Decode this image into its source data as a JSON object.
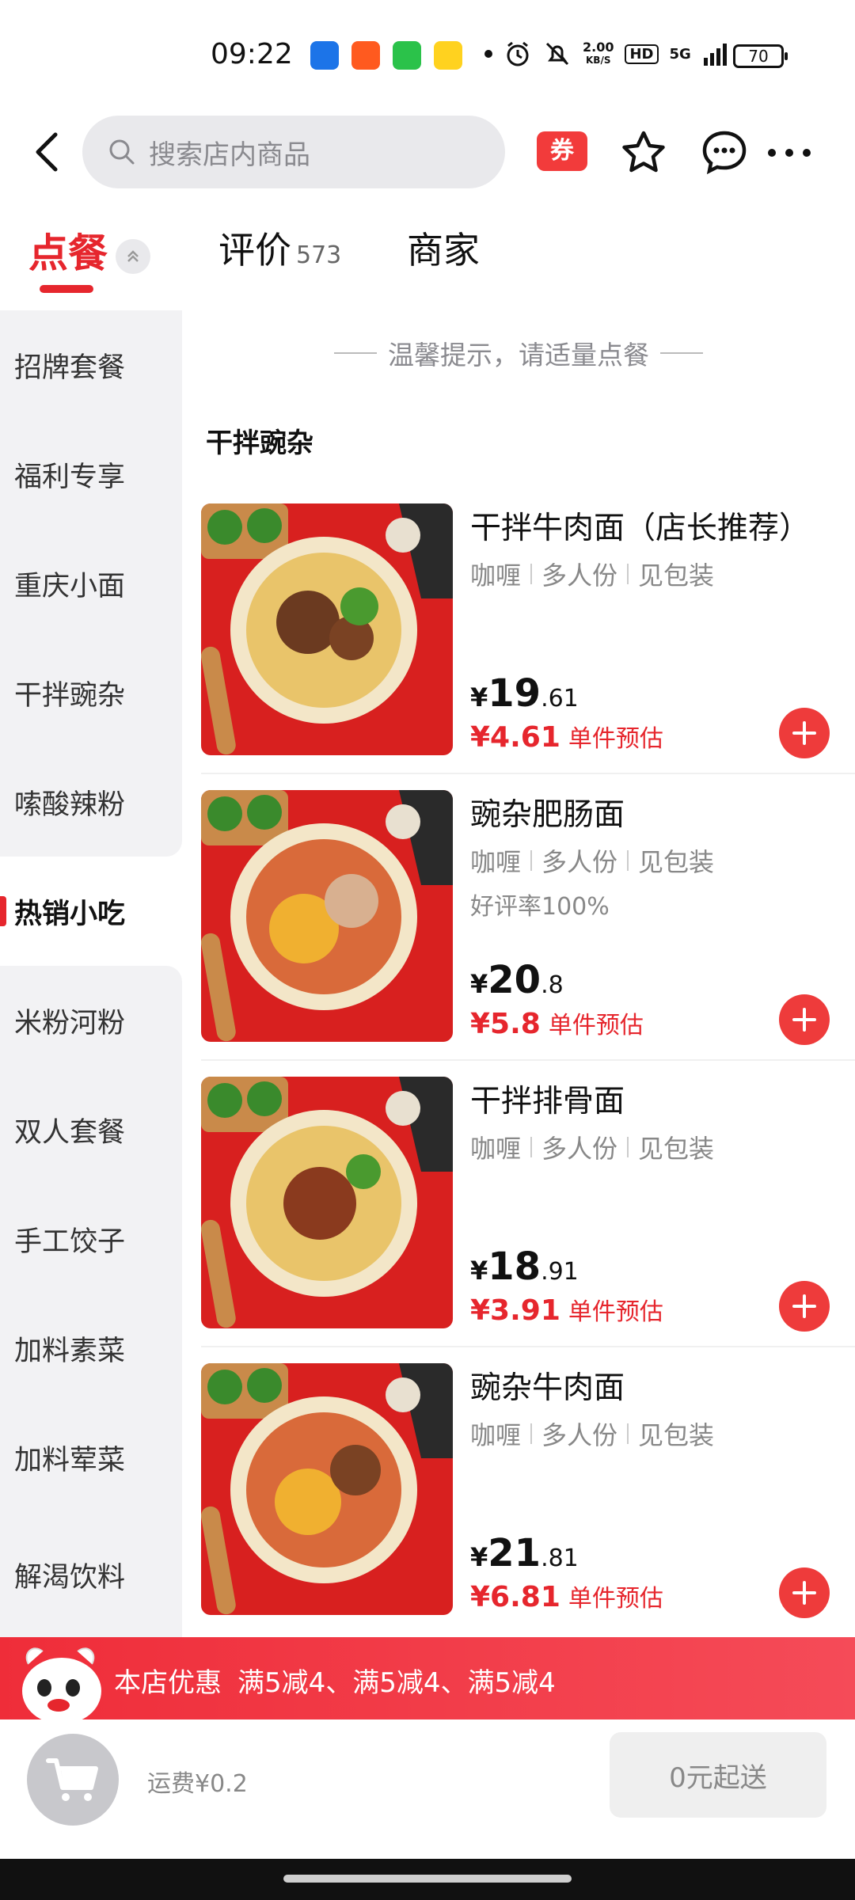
{
  "status_bar": {
    "time": "09:22",
    "speed_top": "2.00",
    "speed_unit": "KB/S",
    "hd_label": "HD",
    "network_label": "5G",
    "battery": "70",
    "app_icons": [
      "ai-app-icon",
      "video-app-icon",
      "camera-app-icon",
      "meituan-app-icon"
    ]
  },
  "topnav": {
    "search_placeholder": "搜索店内商品",
    "coupon_label": "券",
    "icons": [
      "back-arrow-icon",
      "search-icon",
      "star-icon",
      "chat-icon",
      "more-icon"
    ]
  },
  "tabs": [
    {
      "label": "点餐",
      "active": true
    },
    {
      "label": "评价",
      "count": "573"
    },
    {
      "label": "商家"
    }
  ],
  "sidebar": {
    "items": [
      {
        "label": "招牌套餐"
      },
      {
        "label": "福利专享"
      },
      {
        "label": "重庆小面"
      },
      {
        "label": "干拌豌杂"
      },
      {
        "label": "嗦酸辣粉"
      },
      {
        "label": "热销小吃",
        "active": true
      },
      {
        "label": "米粉河粉"
      },
      {
        "label": "双人套餐"
      },
      {
        "label": "手工饺子"
      },
      {
        "label": "加料素菜"
      },
      {
        "label": "加料荤菜"
      },
      {
        "label": "解渴饮料"
      }
    ]
  },
  "main": {
    "tip": "温馨提示，请适量点餐",
    "category_title": "干拌豌杂",
    "products": [
      {
        "name": "干拌牛肉面（店长推荐）",
        "tags": [
          "咖喱",
          "多人份",
          "见包装"
        ],
        "extra": "",
        "price_int": "19",
        "price_dec": ".61",
        "est_amount": "¥4.61",
        "est_label": "单件预估"
      },
      {
        "name": "豌杂肥肠面",
        "tags": [
          "咖喱",
          "多人份",
          "见包装"
        ],
        "extra": "好评率100%",
        "price_int": "20",
        "price_dec": ".8",
        "est_amount": "¥5.8",
        "est_label": "单件预估"
      },
      {
        "name": "干拌排骨面",
        "tags": [
          "咖喱",
          "多人份",
          "见包装"
        ],
        "extra": "",
        "price_int": "18",
        "price_dec": ".91",
        "est_amount": "¥3.91",
        "est_label": "单件预估"
      },
      {
        "name": "豌杂牛肉面",
        "tags": [
          "咖喱",
          "多人份",
          "见包装"
        ],
        "extra": "",
        "price_int": "21",
        "price_dec": ".81",
        "est_amount": "¥6.81",
        "est_label": "单件预估"
      }
    ],
    "currency": "¥"
  },
  "promo": {
    "label": "本店优惠",
    "text": "满5减4、满5减4、满5减4"
  },
  "cart": {
    "delivery_fee": "运费¥0.2",
    "min_order": "0元起送"
  },
  "colors": {
    "accent": "#e6262d",
    "promo_bg": "#ef2d39"
  }
}
